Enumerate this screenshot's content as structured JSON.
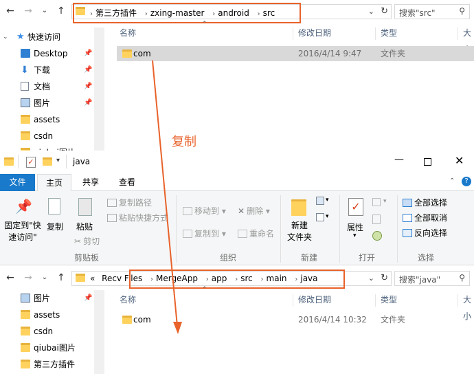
{
  "top_window": {
    "breadcrumb": [
      "第三方插件",
      "zxing-master",
      "android",
      "src"
    ],
    "search_placeholder": "搜索\"src\"",
    "nav_items": [
      {
        "label": "快速访问",
        "icon": "star-icon"
      },
      {
        "label": "Desktop",
        "icon": "desktop-icon",
        "pinned": true
      },
      {
        "label": "下载",
        "icon": "download-icon",
        "pinned": true
      },
      {
        "label": "文档",
        "icon": "document-icon",
        "pinned": true
      },
      {
        "label": "图片",
        "icon": "picture-icon",
        "pinned": true
      },
      {
        "label": "assets",
        "icon": "folder-icon"
      },
      {
        "label": "csdn",
        "icon": "folder-icon"
      },
      {
        "label": "qiubai图片",
        "icon": "folder-icon"
      }
    ],
    "columns": {
      "name": "名称",
      "date": "修改日期",
      "type": "类型",
      "size": "大小"
    },
    "files": [
      {
        "name": "com",
        "date": "2016/4/14 9:47",
        "type": "文件夹"
      }
    ]
  },
  "annotation": "复制",
  "bottom_window": {
    "title": "java",
    "tabs": {
      "file": "文件",
      "home": "主页",
      "share": "共享",
      "view": "查看"
    },
    "ribbon": {
      "pin_quick_access": "固定到\"快\n速访问\"",
      "copy": "复制",
      "paste": "粘贴",
      "copy_path": "复制路径",
      "paste_shortcut": "粘贴快捷方式",
      "cut": "剪切",
      "move_to": "移动到",
      "copy_to": "复制到",
      "delete": "删除",
      "rename": "重命名",
      "new_folder": "新建\n文件夹",
      "properties": "属性",
      "select_all": "全部选择",
      "select_none": "全部取消",
      "invert_selection": "反向选择",
      "groups": {
        "clipboard": "剪贴板",
        "organize": "组织",
        "new": "新建",
        "open": "打开",
        "select": "选择"
      }
    },
    "breadcrumb_prefix": "«",
    "breadcrumb": [
      "Recv Files",
      "MergeApp",
      "app",
      "src",
      "main",
      "java"
    ],
    "search_placeholder": "搜索\"java\"",
    "nav_items": [
      {
        "label": "图片",
        "icon": "picture-icon",
        "pinned": true
      },
      {
        "label": "assets",
        "icon": "folder-icon"
      },
      {
        "label": "csdn",
        "icon": "folder-icon"
      },
      {
        "label": "qiubai图片",
        "icon": "folder-icon"
      },
      {
        "label": "第三方插件",
        "icon": "folder-icon"
      }
    ],
    "columns": {
      "name": "名称",
      "date": "修改日期",
      "type": "类型",
      "size": "大小"
    },
    "files": [
      {
        "name": "com",
        "date": "2016/4/14 10:32",
        "type": "文件夹"
      }
    ]
  },
  "colors": {
    "accent": "#1979ca",
    "highlight": "#e8622a",
    "selected_row": "#d9d9d9"
  }
}
